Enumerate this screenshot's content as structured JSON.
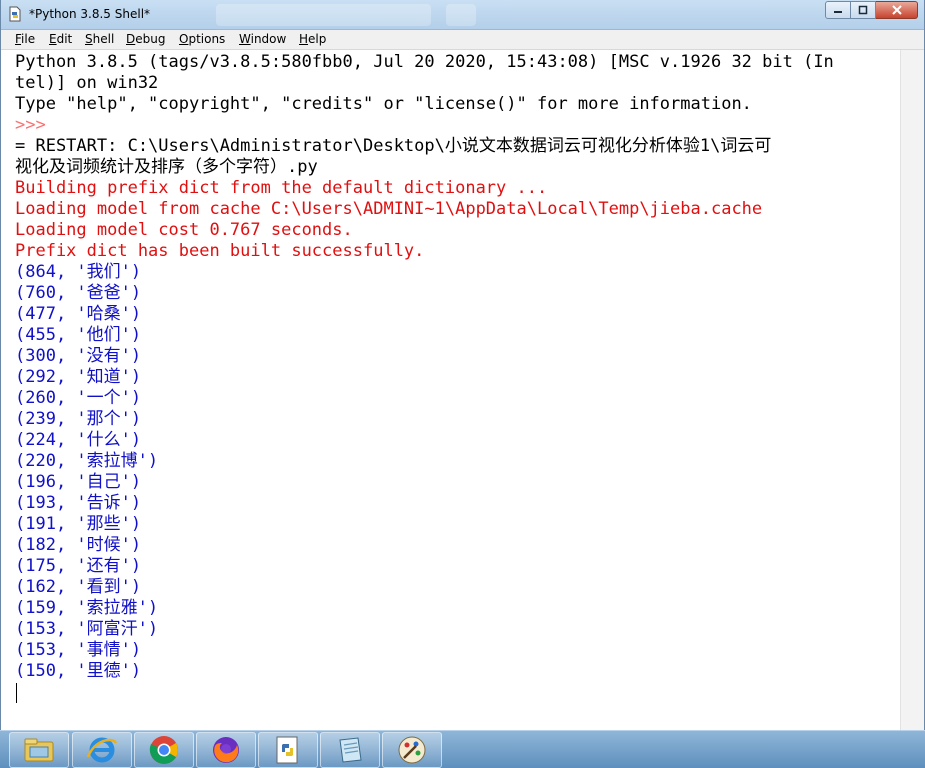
{
  "window": {
    "title": "*Python 3.8.5 Shell*"
  },
  "menu": [
    {
      "label": "File",
      "accel": "F",
      "rest": "ile"
    },
    {
      "label": "Edit",
      "accel": "E",
      "rest": "dit"
    },
    {
      "label": "Shell",
      "accel": "S",
      "rest": "hell"
    },
    {
      "label": "Debug",
      "accel": "D",
      "rest": "ebug"
    },
    {
      "label": "Options",
      "accel": "O",
      "rest": "ptions"
    },
    {
      "label": "Window",
      "accel": "W",
      "rest": "indow"
    },
    {
      "label": "Help",
      "accel": "H",
      "rest": "elp"
    }
  ],
  "shell": {
    "banner1": "Python 3.8.5 (tags/v3.8.5:580fbb0, Jul 20 2020, 15:43:08) [MSC v.1926 32 bit (In",
    "banner2": "tel)] on win32",
    "banner3": "Type \"help\", \"copyright\", \"credits\" or \"license()\" for more information.",
    "prompt": ">>>",
    "restart1": "= RESTART: C:\\Users\\Administrator\\Desktop\\小说文本数据词云可视化分析体验1\\词云可",
    "restart2": "视化及词频统计及排序（多个字符）.py",
    "jieba1": "Building prefix dict from the default dictionary ...",
    "jieba2": "Loading model from cache C:\\Users\\ADMINI~1\\AppData\\Local\\Temp\\jieba.cache",
    "jieba3": "Loading model cost 0.767 seconds.",
    "jieba4": "Prefix dict has been built successfully.",
    "results": [
      "(864, '我们')",
      "(760, '爸爸')",
      "(477, '哈桑')",
      "(455, '他们')",
      "(300, '没有')",
      "(292, '知道')",
      "(260, '一个')",
      "(239, '那个')",
      "(224, '什么')",
      "(220, '索拉博')",
      "(196, '自己')",
      "(193, '告诉')",
      "(191, '那些')",
      "(182, '时候')",
      "(175, '还有')",
      "(162, '看到')",
      "(159, '索拉雅')",
      "(153, '阿富汗')",
      "(153, '事情')",
      "(150, '里德')"
    ]
  },
  "taskbar": {
    "items": [
      "file-explorer-icon",
      "internet-explorer-icon",
      "chrome-icon",
      "firefox-icon",
      "python-idle-icon",
      "notepad-icon",
      "paint-icon"
    ]
  }
}
